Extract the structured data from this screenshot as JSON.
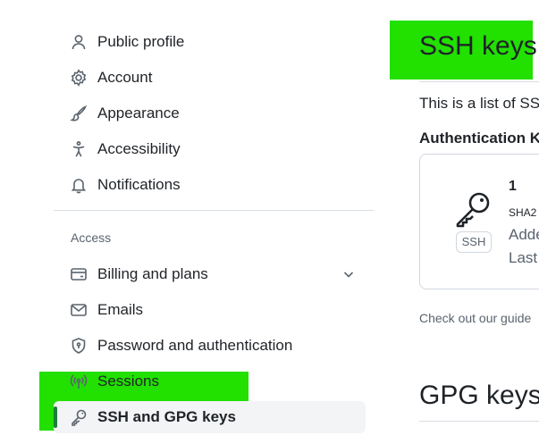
{
  "sidebar": {
    "items": [
      {
        "label": "Public profile",
        "icon": "person-icon"
      },
      {
        "label": "Account",
        "icon": "gear-icon"
      },
      {
        "label": "Appearance",
        "icon": "paintbrush-icon"
      },
      {
        "label": "Accessibility",
        "icon": "accessibility-icon"
      },
      {
        "label": "Notifications",
        "icon": "bell-icon"
      }
    ],
    "access_section_label": "Access",
    "access_items": [
      {
        "label": "Billing and plans",
        "icon": "credit-card-icon",
        "has_submenu": true
      },
      {
        "label": "Emails",
        "icon": "mail-icon"
      },
      {
        "label": "Password and authentication",
        "icon": "shield-lock-icon"
      },
      {
        "label": "Sessions",
        "icon": "broadcast-icon"
      },
      {
        "label": "SSH and GPG keys",
        "icon": "key-icon",
        "active": true
      }
    ]
  },
  "main": {
    "title": "SSH keys",
    "intro": "This is a list of SSI",
    "auth_heading": "Authentication K",
    "key_card": {
      "name": "1",
      "fingerprint_prefix": "SHA2",
      "badge": "SSH",
      "added_text": "Adde",
      "last_used_text": "Last"
    },
    "guide_text": "Check out our guide",
    "gpg_title": "GPG keys"
  },
  "colors": {
    "highlight": "#22e000",
    "active_indicator": "#1a7f37",
    "active_background": "#f3f4f6",
    "divider": "#d8dee4",
    "muted_text": "#59636e"
  }
}
